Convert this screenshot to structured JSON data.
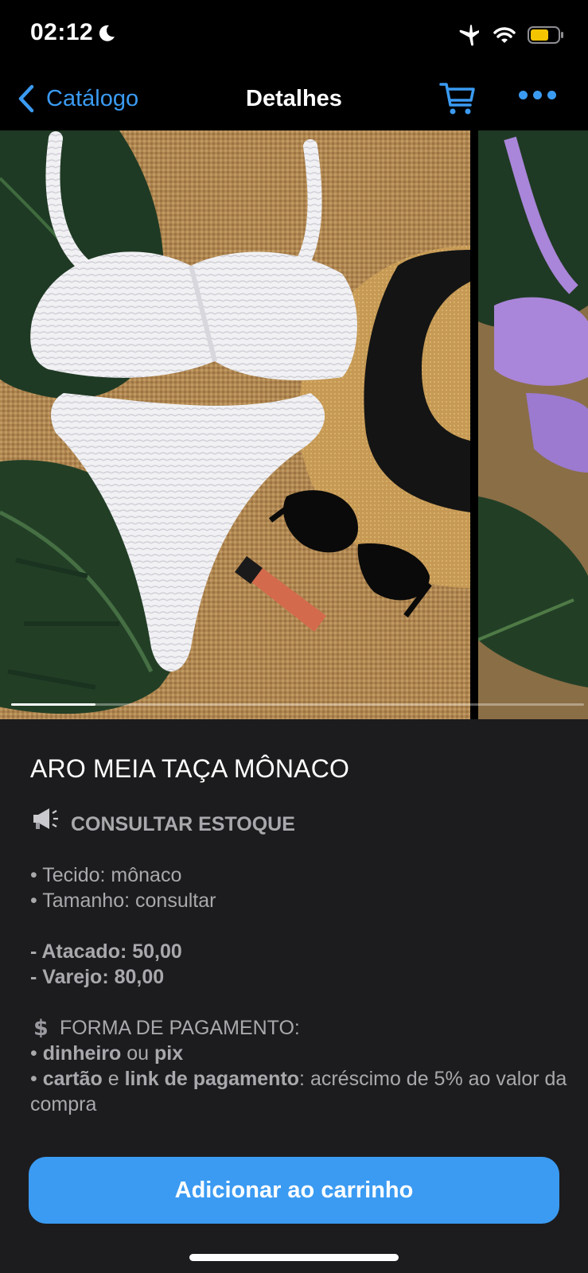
{
  "status_bar": {
    "time": "02:12"
  },
  "nav": {
    "back_label": "Catálogo",
    "title": "Detalhes"
  },
  "gallery": {
    "photo_count_visible": 2,
    "current_index": 1
  },
  "product": {
    "title": "ARO MEIA TAÇA MÔNACO",
    "stock_notice": "CONSULTAR ESTOQUE",
    "fabric_label": "Tecido",
    "fabric_value": "mônaco",
    "size_label": "Tamanho",
    "size_value": "consultar",
    "wholesale": "- Atacado: 50,00",
    "retail": "- Varejo: 80,00",
    "payment_heading": "FORMA DE PAGAMENTO:",
    "payment_cash": "dinheiro",
    "payment_or": "ou",
    "payment_pix": "pix",
    "payment_card": "cartão",
    "payment_and": "e",
    "payment_link": "link de pagamento",
    "payment_surcharge": ": acréscimo de 5% ao valor da compra"
  },
  "actions": {
    "add_to_cart": "Adicionar ao carrinho"
  },
  "colors": {
    "accent": "#3b9bf2",
    "content_bg": "#1c1c1e",
    "muted_text": "#a9a9ad"
  },
  "icons": {
    "moon": "moon-icon",
    "airplane": "airplane-icon",
    "wifi": "wifi-icon",
    "battery": "battery-icon",
    "back": "chevron-left-icon",
    "cart": "cart-icon",
    "more": "more-icon",
    "megaphone": "megaphone-icon",
    "dollar": "dollar-icon"
  }
}
